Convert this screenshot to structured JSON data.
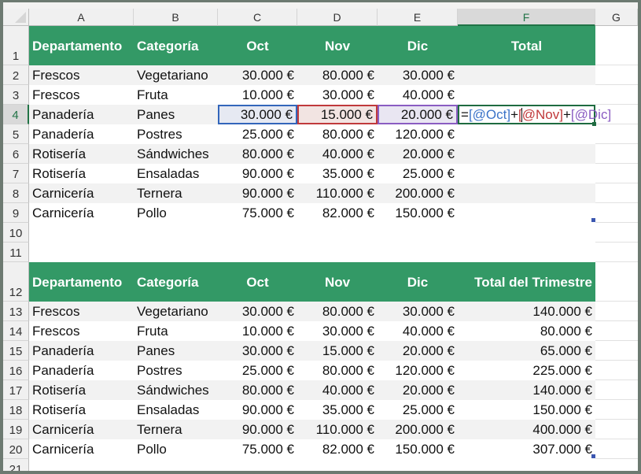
{
  "columns": [
    "A",
    "B",
    "C",
    "D",
    "E",
    "F",
    "G"
  ],
  "selected_column": "F",
  "selected_row": 4,
  "row_numbers": [
    1,
    2,
    3,
    4,
    5,
    6,
    7,
    8,
    9,
    10,
    11,
    12,
    13,
    14,
    15,
    16,
    17,
    18,
    19,
    20,
    21
  ],
  "table1": {
    "headers": [
      "Departamento",
      "Categoría",
      "Oct",
      "Nov",
      "Dic",
      "Total"
    ],
    "rows": [
      [
        "Frescos",
        "Vegetariano",
        "30.000 €",
        "80.000 €",
        "30.000 €",
        ""
      ],
      [
        "Frescos",
        "Fruta",
        "10.000 €",
        "30.000 €",
        "40.000 €",
        ""
      ],
      [
        "Panadería",
        "Panes",
        "30.000 €",
        "15.000 €",
        "20.000 €",
        ""
      ],
      [
        "Panadería",
        "Postres",
        "25.000 €",
        "80.000 €",
        "120.000 €",
        ""
      ],
      [
        "Rotisería",
        "Sándwiches",
        "80.000 €",
        "40.000 €",
        "20.000 €",
        ""
      ],
      [
        "Rotisería",
        "Ensaladas",
        "90.000 €",
        "35.000 €",
        "25.000 €",
        ""
      ],
      [
        "Carnicería",
        "Ternera",
        "90.000 €",
        "110.000 €",
        "200.000 €",
        ""
      ],
      [
        "Carnicería",
        "Pollo",
        "75.000 €",
        "82.000 €",
        "150.000 €",
        ""
      ]
    ]
  },
  "active_cell_formula": {
    "parts": [
      {
        "text": "=",
        "color": "black"
      },
      {
        "text": "[@Oct]",
        "color": "blue"
      },
      {
        "text": "+",
        "color": "black"
      },
      {
        "text": "[",
        "color": "red"
      },
      {
        "text": "@Nov]",
        "color": "red"
      },
      {
        "text": "+",
        "color": "black"
      },
      {
        "text": "[@Dic]",
        "color": "purple"
      }
    ]
  },
  "table2": {
    "headers": [
      "Departamento",
      "Categoría",
      "Oct",
      "Nov",
      "Dic",
      "Total del Trimestre"
    ],
    "rows": [
      [
        "Frescos",
        "Vegetariano",
        "30.000 €",
        "80.000 €",
        "30.000 €",
        "140.000 €"
      ],
      [
        "Frescos",
        "Fruta",
        "10.000 €",
        "30.000 €",
        "40.000 €",
        "80.000 €"
      ],
      [
        "Panadería",
        "Panes",
        "30.000 €",
        "15.000 €",
        "20.000 €",
        "65.000 €"
      ],
      [
        "Panadería",
        "Postres",
        "25.000 €",
        "80.000 €",
        "120.000 €",
        "225.000 €"
      ],
      [
        "Rotisería",
        "Sándwiches",
        "80.000 €",
        "40.000 €",
        "20.000 €",
        "140.000 €"
      ],
      [
        "Rotisería",
        "Ensaladas",
        "90.000 €",
        "35.000 €",
        "25.000 €",
        "150.000 €"
      ],
      [
        "Carnicería",
        "Ternera",
        "90.000 €",
        "110.000 €",
        "200.000 €",
        "400.000 €"
      ],
      [
        "Carnicería",
        "Pollo",
        "75.000 €",
        "82.000 €",
        "150.000 €",
        "307.000 €"
      ]
    ]
  },
  "colors": {
    "header_green": "#339966",
    "active_border": "#1e6b40",
    "ref_oct": "#3366bb",
    "ref_nov": "#c0393b",
    "ref_dic": "#8a5cc2"
  }
}
